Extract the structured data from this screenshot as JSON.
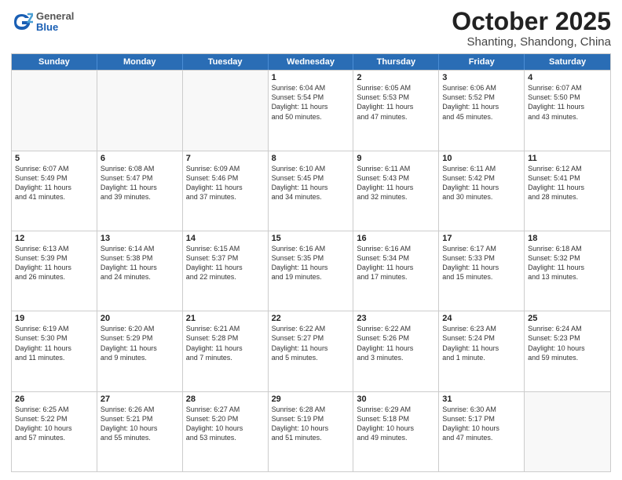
{
  "header": {
    "logo_general": "General",
    "logo_blue": "Blue",
    "month": "October 2025",
    "location": "Shanting, Shandong, China"
  },
  "weekdays": [
    "Sunday",
    "Monday",
    "Tuesday",
    "Wednesday",
    "Thursday",
    "Friday",
    "Saturday"
  ],
  "rows": [
    [
      {
        "day": "",
        "info": ""
      },
      {
        "day": "",
        "info": ""
      },
      {
        "day": "",
        "info": ""
      },
      {
        "day": "1",
        "info": "Sunrise: 6:04 AM\nSunset: 5:54 PM\nDaylight: 11 hours\nand 50 minutes."
      },
      {
        "day": "2",
        "info": "Sunrise: 6:05 AM\nSunset: 5:53 PM\nDaylight: 11 hours\nand 47 minutes."
      },
      {
        "day": "3",
        "info": "Sunrise: 6:06 AM\nSunset: 5:52 PM\nDaylight: 11 hours\nand 45 minutes."
      },
      {
        "day": "4",
        "info": "Sunrise: 6:07 AM\nSunset: 5:50 PM\nDaylight: 11 hours\nand 43 minutes."
      }
    ],
    [
      {
        "day": "5",
        "info": "Sunrise: 6:07 AM\nSunset: 5:49 PM\nDaylight: 11 hours\nand 41 minutes."
      },
      {
        "day": "6",
        "info": "Sunrise: 6:08 AM\nSunset: 5:47 PM\nDaylight: 11 hours\nand 39 minutes."
      },
      {
        "day": "7",
        "info": "Sunrise: 6:09 AM\nSunset: 5:46 PM\nDaylight: 11 hours\nand 37 minutes."
      },
      {
        "day": "8",
        "info": "Sunrise: 6:10 AM\nSunset: 5:45 PM\nDaylight: 11 hours\nand 34 minutes."
      },
      {
        "day": "9",
        "info": "Sunrise: 6:11 AM\nSunset: 5:43 PM\nDaylight: 11 hours\nand 32 minutes."
      },
      {
        "day": "10",
        "info": "Sunrise: 6:11 AM\nSunset: 5:42 PM\nDaylight: 11 hours\nand 30 minutes."
      },
      {
        "day": "11",
        "info": "Sunrise: 6:12 AM\nSunset: 5:41 PM\nDaylight: 11 hours\nand 28 minutes."
      }
    ],
    [
      {
        "day": "12",
        "info": "Sunrise: 6:13 AM\nSunset: 5:39 PM\nDaylight: 11 hours\nand 26 minutes."
      },
      {
        "day": "13",
        "info": "Sunrise: 6:14 AM\nSunset: 5:38 PM\nDaylight: 11 hours\nand 24 minutes."
      },
      {
        "day": "14",
        "info": "Sunrise: 6:15 AM\nSunset: 5:37 PM\nDaylight: 11 hours\nand 22 minutes."
      },
      {
        "day": "15",
        "info": "Sunrise: 6:16 AM\nSunset: 5:35 PM\nDaylight: 11 hours\nand 19 minutes."
      },
      {
        "day": "16",
        "info": "Sunrise: 6:16 AM\nSunset: 5:34 PM\nDaylight: 11 hours\nand 17 minutes."
      },
      {
        "day": "17",
        "info": "Sunrise: 6:17 AM\nSunset: 5:33 PM\nDaylight: 11 hours\nand 15 minutes."
      },
      {
        "day": "18",
        "info": "Sunrise: 6:18 AM\nSunset: 5:32 PM\nDaylight: 11 hours\nand 13 minutes."
      }
    ],
    [
      {
        "day": "19",
        "info": "Sunrise: 6:19 AM\nSunset: 5:30 PM\nDaylight: 11 hours\nand 11 minutes."
      },
      {
        "day": "20",
        "info": "Sunrise: 6:20 AM\nSunset: 5:29 PM\nDaylight: 11 hours\nand 9 minutes."
      },
      {
        "day": "21",
        "info": "Sunrise: 6:21 AM\nSunset: 5:28 PM\nDaylight: 11 hours\nand 7 minutes."
      },
      {
        "day": "22",
        "info": "Sunrise: 6:22 AM\nSunset: 5:27 PM\nDaylight: 11 hours\nand 5 minutes."
      },
      {
        "day": "23",
        "info": "Sunrise: 6:22 AM\nSunset: 5:26 PM\nDaylight: 11 hours\nand 3 minutes."
      },
      {
        "day": "24",
        "info": "Sunrise: 6:23 AM\nSunset: 5:24 PM\nDaylight: 11 hours\nand 1 minute."
      },
      {
        "day": "25",
        "info": "Sunrise: 6:24 AM\nSunset: 5:23 PM\nDaylight: 10 hours\nand 59 minutes."
      }
    ],
    [
      {
        "day": "26",
        "info": "Sunrise: 6:25 AM\nSunset: 5:22 PM\nDaylight: 10 hours\nand 57 minutes."
      },
      {
        "day": "27",
        "info": "Sunrise: 6:26 AM\nSunset: 5:21 PM\nDaylight: 10 hours\nand 55 minutes."
      },
      {
        "day": "28",
        "info": "Sunrise: 6:27 AM\nSunset: 5:20 PM\nDaylight: 10 hours\nand 53 minutes."
      },
      {
        "day": "29",
        "info": "Sunrise: 6:28 AM\nSunset: 5:19 PM\nDaylight: 10 hours\nand 51 minutes."
      },
      {
        "day": "30",
        "info": "Sunrise: 6:29 AM\nSunset: 5:18 PM\nDaylight: 10 hours\nand 49 minutes."
      },
      {
        "day": "31",
        "info": "Sunrise: 6:30 AM\nSunset: 5:17 PM\nDaylight: 10 hours\nand 47 minutes."
      },
      {
        "day": "",
        "info": ""
      }
    ]
  ]
}
